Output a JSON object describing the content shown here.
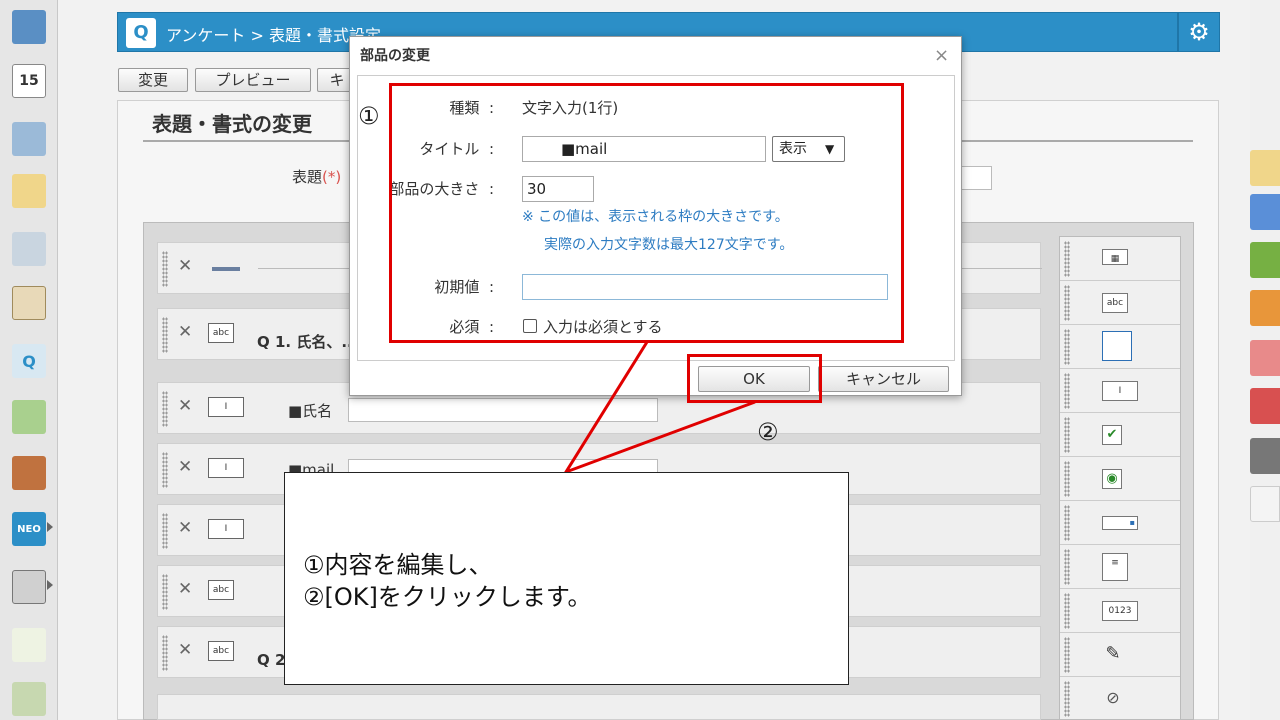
{
  "breadcrumb": "アンケート > 表題・書式設定",
  "toolbar": {
    "edit": "変更",
    "preview": "プレビュー",
    "third": "キ"
  },
  "page": {
    "heading": "表題・書式の変更",
    "hyodai_label": "表題",
    "required_mark": "(*)"
  },
  "form_rows": [
    {
      "type": "divider"
    },
    {
      "type": "text",
      "icon": "abc",
      "label": "Q 1. 氏名、..."
    },
    {
      "type": "input",
      "icon": "I",
      "label": "■氏名"
    },
    {
      "type": "input",
      "icon": "I",
      "label": "■mail"
    },
    {
      "type": "input",
      "icon": "I",
      "label": ""
    },
    {
      "type": "text",
      "icon": "abc",
      "label": ""
    },
    {
      "type": "text",
      "icon": "abc",
      "label": "Q 2"
    }
  ],
  "palette_icons": [
    "abc",
    "0123"
  ],
  "dialog": {
    "title": "部品の変更",
    "close": "×",
    "type_label": "種類",
    "type_value": "文字入力(1行)",
    "title_label": "タイトル",
    "title_value": "■mail",
    "display_select": "表示",
    "size_label": "部品の大きさ",
    "size_value": "30",
    "note1": "※ この値は、表示される枠の大きさです。",
    "note2": "実際の入力文字数は最大127文字です。",
    "default_label": "初期値",
    "default_value": "",
    "required_label": "必須",
    "required_checkbox": "入力は必須とする",
    "colon": ":",
    "ok": "OK",
    "cancel": "キャンセル"
  },
  "annotations": {
    "marker1": "①",
    "marker2": "②",
    "callout_line1": "①内容を編集し、",
    "callout_line2": "②[OK]をクリックします。",
    "highlight_color": "#e00000"
  }
}
